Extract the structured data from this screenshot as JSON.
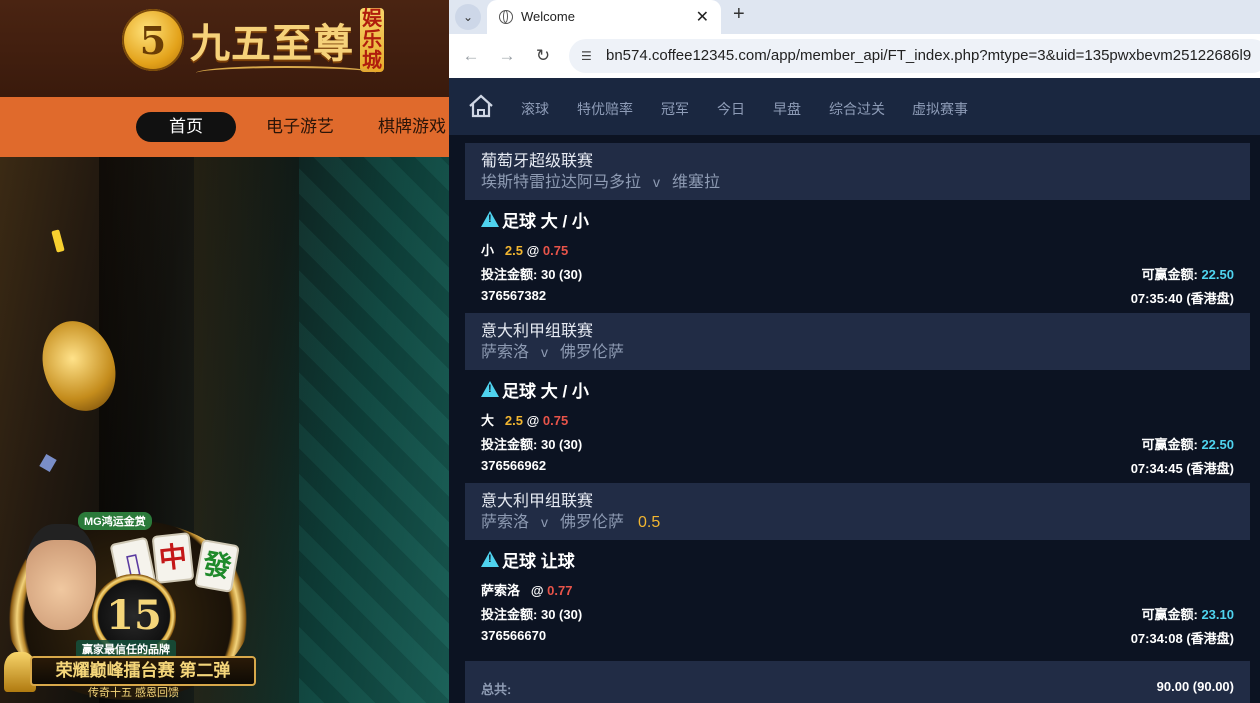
{
  "casino": {
    "logo_mark": "5",
    "logo_name": "九五至尊",
    "logo_badge": "娱乐城",
    "nav": [
      "首页",
      "电子游艺",
      "棋牌游戏"
    ],
    "promo": {
      "brand": "MG鸿运金赏",
      "tiles": [
        "中",
        "發",
        "▯"
      ],
      "anniversary": "15",
      "tagline": "赢家最信任的品牌",
      "headline": "荣耀巅峰擂台赛 第二弹",
      "subline": "传奇十五 感恩回馈"
    }
  },
  "browser": {
    "tab_title": "Welcome",
    "url": "bn574.coffee12345.com/app/member_api/FT_index.php?mtype=3&uid=135pwxbevm25122686l9"
  },
  "site_nav": [
    "滚球",
    "特优赔率",
    "冠军",
    "今日",
    "早盘",
    "综合过关",
    "虚拟赛事"
  ],
  "bets": [
    {
      "league": "葡萄牙超级联赛",
      "home": "埃斯特雷拉达阿马多拉",
      "vs": "v",
      "away": "维塞拉",
      "handicap": "",
      "type": "足球 大 / 小",
      "pick": "小",
      "line": "2.5",
      "at": "@",
      "odds": "0.75",
      "stake_label": "投注金额:",
      "stake": "30 (30)",
      "win_label": "可赢金额:",
      "win": "22.50",
      "ticket": "376567382",
      "time": "07:35:40 (香港盘)"
    },
    {
      "league": "意大利甲组联赛",
      "home": "萨索洛",
      "vs": "v",
      "away": "佛罗伦萨",
      "handicap": "",
      "type": "足球 大 / 小",
      "pick": "大",
      "line": "2.5",
      "at": "@",
      "odds": "0.75",
      "stake_label": "投注金额:",
      "stake": "30 (30)",
      "win_label": "可赢金额:",
      "win": "22.50",
      "ticket": "376566962",
      "time": "07:34:45 (香港盘)"
    },
    {
      "league": "意大利甲组联赛",
      "home": "萨索洛",
      "vs": "v",
      "away": "佛罗伦萨",
      "handicap": "0.5",
      "type": "足球 让球",
      "pick": "萨索洛",
      "line": "",
      "at": "@",
      "odds": "0.77",
      "stake_label": "投注金额:",
      "stake": "30 (30)",
      "win_label": "可赢金额:",
      "win": "23.10",
      "ticket": "376566670",
      "time": "07:34:08 (香港盘)"
    }
  ],
  "total": {
    "label": "总共:",
    "value": "90.00 (90.00)"
  }
}
